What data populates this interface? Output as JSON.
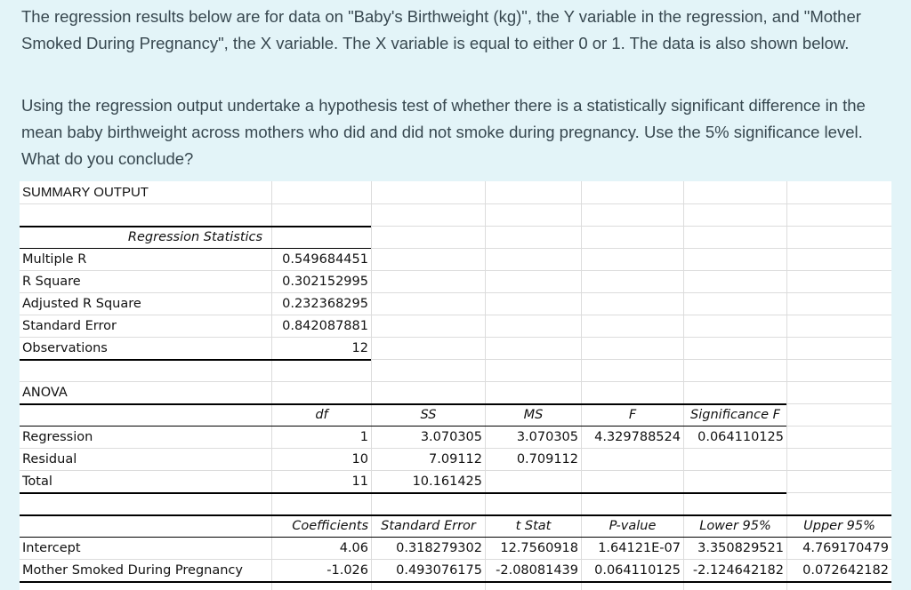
{
  "question": {
    "paragraph1": "The regression results below are for data on \"Baby's Birthweight (kg)\", the Y variable in the regression, and \"Mother Smoked During Pregnancy\", the X variable. The X variable is equal to either 0 or 1. The data is also shown below.",
    "paragraph2": "Using the regression output undertake a hypothesis test of whether there is a statistically significant difference in the mean baby birthweight across mothers who did and did not smoke during pregnancy. Use the 5% significance level. What do you conclude?"
  },
  "spreadsheet": {
    "title": "SUMMARY OUTPUT",
    "regression_statistics": {
      "header": "Regression Statistics",
      "rows": [
        {
          "label": "Multiple R",
          "value": "0.549684451"
        },
        {
          "label": "R Square",
          "value": "0.302152995"
        },
        {
          "label": "Adjusted R Square",
          "value": "0.232368295"
        },
        {
          "label": "Standard Error",
          "value": "0.842087881"
        },
        {
          "label": "Observations",
          "value": "12"
        }
      ]
    },
    "anova": {
      "title": "ANOVA",
      "headers": [
        "df",
        "SS",
        "MS",
        "F",
        "Significance F"
      ],
      "rows": [
        {
          "label": "Regression",
          "df": "1",
          "ss": "3.070305",
          "ms": "3.070305",
          "f": "4.329788524",
          "sig_f": "0.064110125"
        },
        {
          "label": "Residual",
          "df": "10",
          "ss": "7.09112",
          "ms": "0.709112",
          "f": "",
          "sig_f": ""
        },
        {
          "label": "Total",
          "df": "11",
          "ss": "10.161425",
          "ms": "",
          "f": "",
          "sig_f": ""
        }
      ]
    },
    "coefficients": {
      "headers": [
        "Coefficients",
        "Standard Error",
        "t Stat",
        "P-value",
        "Lower 95%",
        "Upper 95%"
      ],
      "rows": [
        {
          "label": "Intercept",
          "coef": "4.06",
          "se": "0.318279302",
          "t": "12.7560918",
          "p": "1.64121E-07",
          "lower": "3.350829521",
          "upper": "4.769170479"
        },
        {
          "label": "Mother Smoked During Pregnancy",
          "coef": "-1.026",
          "se": "0.493076175",
          "t": "-2.08081439",
          "p": "0.064110125",
          "lower": "-2.124642182",
          "upper": "0.072642182"
        }
      ]
    }
  }
}
